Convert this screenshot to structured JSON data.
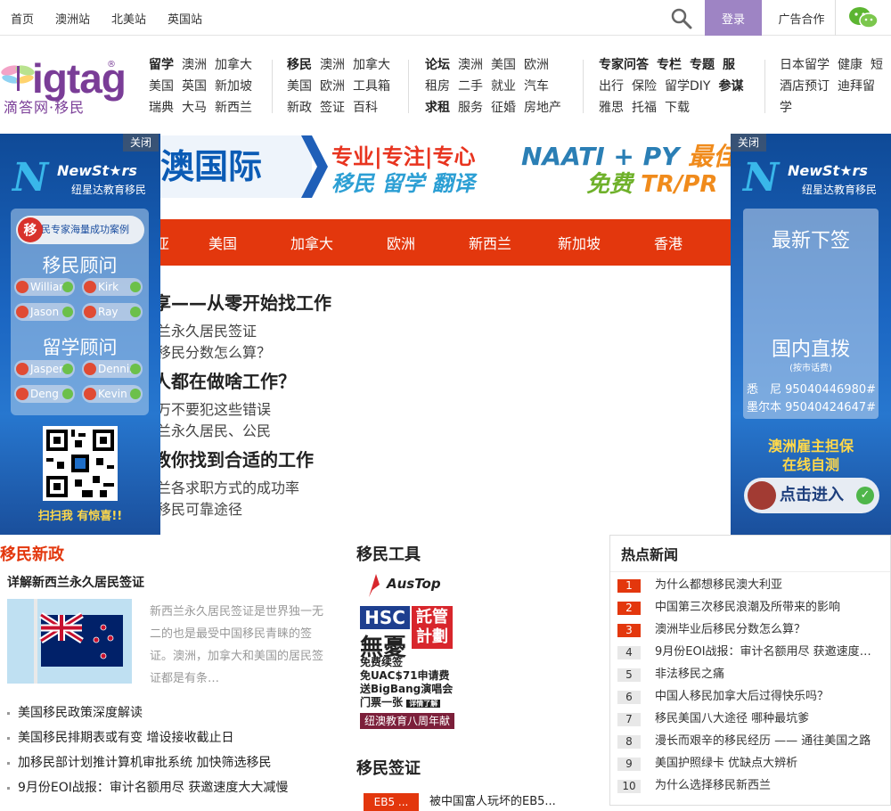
{
  "topbar": {
    "sites": [
      "首页",
      "澳洲站",
      "北美站",
      "英国站"
    ],
    "login": "登录",
    "ad": "广告合作"
  },
  "logo": {
    "word": "igtag",
    "reg": "®",
    "tagline": "滴答网·移民"
  },
  "nav": [
    {
      "rows": [
        [
          "留学",
          "澳洲",
          "加拿大"
        ],
        [
          "美国",
          "英国",
          "新加坡"
        ],
        [
          "瑞典",
          "大马",
          "新西兰"
        ]
      ],
      "bold": [
        "留学"
      ]
    },
    {
      "rows": [
        [
          "移民",
          "澳洲",
          "加拿大"
        ],
        [
          "美国",
          "欧洲",
          "工具箱"
        ],
        [
          "新政",
          "签证",
          "百科"
        ]
      ],
      "bold": [
        "移民"
      ]
    },
    {
      "rows": [
        [
          "论坛",
          "澳洲",
          "美国",
          "欧洲"
        ],
        [
          "租房",
          "二手",
          "就业",
          "汽车"
        ],
        [
          "求租",
          "服务",
          "征婚",
          "房地产"
        ]
      ],
      "bold": [
        "论坛",
        "求租"
      ]
    },
    {
      "rows": [
        [
          "专家问答",
          "专栏",
          "专题",
          "服"
        ],
        [
          "出行",
          "保险",
          "留学DIY",
          "参谋"
        ],
        [
          "雅思",
          "托福",
          "下载"
        ]
      ],
      "bold": [
        "专家问答",
        "专栏",
        "专题",
        "服",
        "参谋"
      ]
    },
    {
      "rows": [
        [
          "日本留学",
          "健康",
          "短"
        ],
        [
          "酒店预订",
          "迪拜留"
        ],
        [
          "学"
        ]
      ],
      "bold": []
    }
  ],
  "left_banner": {
    "close": "关闭",
    "brand_en": "NewSt★rs",
    "brand_cn": "纽星达教育移民",
    "case_btn": "民专家海量成功案例",
    "case_icon": "移",
    "immigration_title": "移民顾问",
    "immigration_advisors": [
      "William",
      "Kirk",
      "Jason",
      "Ray"
    ],
    "study_title": "留学顾问",
    "study_advisors": [
      "Jasper",
      "Dennis",
      "Deng",
      "Kevin"
    ],
    "qr_caption": "扫扫我 有惊喜!!"
  },
  "right_banner": {
    "close": "关闭",
    "brand_en": "NewSt★rs",
    "brand_cn": "纽星达教育移民",
    "latest": "最新下签",
    "direct": "国内直拨",
    "direct_note": "(按市话费)",
    "phones": [
      "悉　尼 95040446980#",
      "墨尔本 95040424647#"
    ],
    "employer_1": "澳洲雇主担保",
    "employer_2": "在线自测",
    "enter": "点击进入"
  },
  "top_ad": {
    "brand": "澳国际",
    "slogan_1": "专业|专注|专心",
    "slogan_2": "移民 留学 翻译",
    "naati": "NAATI + PY",
    "naati_tail": " 最佳",
    "free": "免费",
    "free_tail": " TR/PR"
  },
  "countries": [
    "美国",
    "加拿大",
    "欧洲",
    "新西兰",
    "新加坡",
    "香港"
  ],
  "countries_partial": "亚",
  "headlines": {
    "big": [
      "享——从零开始找工作",
      "人都在做啥工作？",
      "教你找到合适的工作"
    ],
    "small": [
      "兰永久居民签证",
      "移民分数怎么算？",
      "万不要犯这些错误",
      "兰永久居民、公民",
      "兰各求职方式的成功率",
      "移民可靠途径"
    ]
  },
  "policy": {
    "title": "移民新政",
    "subtitle": "详解新西兰永久居民签证",
    "desc": "新西兰永久居民签证是世界独一无二的也是最受中国移民青睐的签证。澳洲，加拿大和美国的居民签证都是有条…",
    "list": [
      "美国移民政策深度解读",
      "美国移民排期表或有变 增设接收截止日",
      "加移民部计划推计算机审批系统 加快筛选移民",
      "9月份EOI战报：审计名额用尽 获邀速度大大减慢"
    ]
  },
  "tools": {
    "title": "移民工具",
    "austop": "AusTop",
    "hsc": "HSC",
    "hsc_right": "託管計劃",
    "no_worry": "無憂",
    "lines": [
      "免费续签",
      "免UAC$71申请费",
      "送BigBang演唱会",
      "门票一张"
    ],
    "detail_btn": "详情了解",
    "footer": "纽澳教育八周年献礼"
  },
  "visa": {
    "title": "移民签证",
    "tag": "EB5 ...",
    "text": "被中国富人玩坏的EB5..."
  },
  "hot": {
    "title": "热点新闻",
    "items": [
      "为什么都想移民澳大利亚",
      "中国第三次移民浪潮及所带来的影响",
      "澳洲毕业后移民分数怎么算？",
      "9月份EOI战报：审计名额用尽 获邀速度大大减慢",
      "非法移民之痛",
      "中国人移民加拿大后过得快乐吗？",
      "移民美国八大途径 哪种最坑爹",
      "漫长而艰辛的移民经历 —— 通往美国之路",
      "美国护照绿卡 优缺点大辨析",
      "为什么选择移民新西兰"
    ],
    "numbers": [
      "1",
      "2",
      "3",
      "4",
      "5",
      "6",
      "7",
      "8",
      "9",
      "10"
    ]
  }
}
